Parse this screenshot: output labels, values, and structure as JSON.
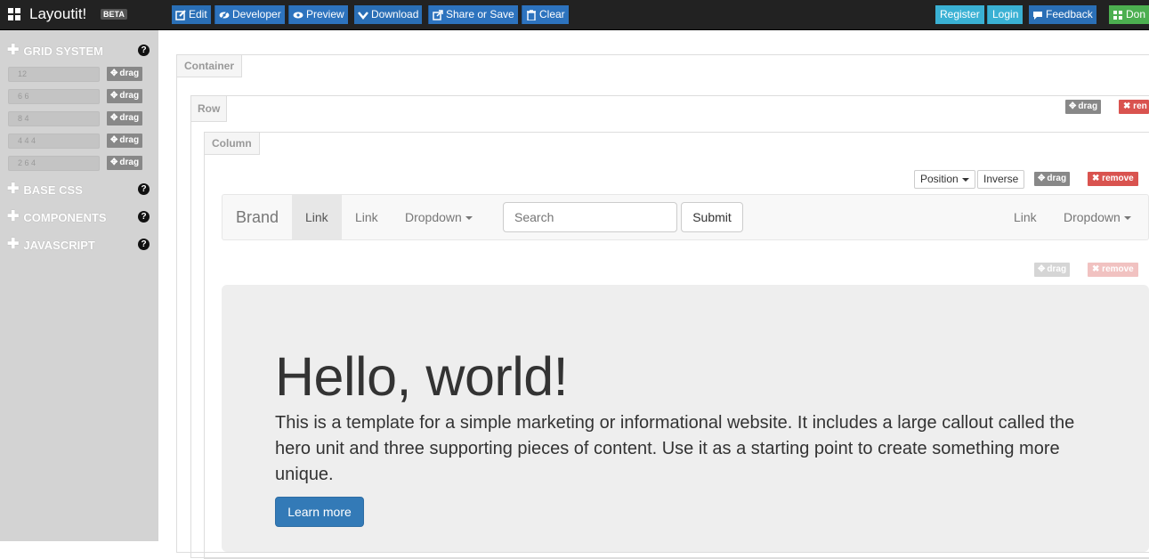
{
  "app": {
    "title": "Layoutit!",
    "badge": "BETA"
  },
  "toolbar": {
    "edit": "Edit",
    "developer": "Developer",
    "preview": "Preview",
    "download": "Download",
    "share": "Share or Save",
    "clear": "Clear",
    "register": "Register",
    "login": "Login",
    "feedback": "Feedback",
    "donate": "Don"
  },
  "sidebar": {
    "sections": [
      {
        "label": "GRID SYSTEM",
        "help": "?"
      },
      {
        "label": "BASE CSS",
        "help": "?"
      },
      {
        "label": "COMPONENTS",
        "help": "?"
      },
      {
        "label": "JAVASCRIPT",
        "help": "?"
      }
    ],
    "grid_rows": [
      "12",
      "6 6",
      "8 4",
      "4 4 4",
      "2 6 4"
    ],
    "drag_label": "drag"
  },
  "canvas": {
    "container_label": "Container",
    "row_label": "Row",
    "column_label": "Column",
    "drag": "drag",
    "remove": "remove",
    "remove_cut": "ren",
    "position": "Position",
    "inverse": "Inverse"
  },
  "navbar": {
    "brand": "Brand",
    "link_active": "Link",
    "link": "Link",
    "dropdown": "Dropdown",
    "search_placeholder": "Search",
    "submit": "Submit",
    "right_link": "Link",
    "right_dropdown": "Dropdown"
  },
  "jumbotron": {
    "heading": "Hello, world!",
    "text": "This is a template for a simple marketing or informational website. It includes a large callout called the hero unit and three supporting pieces of content. Use it as a starting point to create something more unique.",
    "button": "Learn more"
  },
  "colors": {
    "topbar": "#222222",
    "toolbar_blue": "#2a6fb6",
    "toolbar_cyan": "#3ab1d4",
    "toolbar_green": "#4caf50",
    "sidebar": "#d3d3d3",
    "remove_red": "#d9534f",
    "primary": "#337ab7"
  }
}
